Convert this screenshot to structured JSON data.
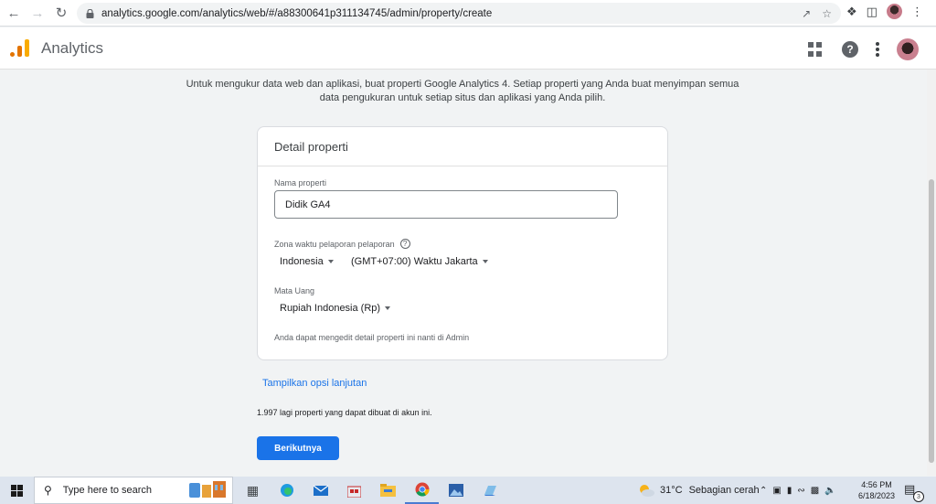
{
  "browser": {
    "url": "analytics.google.com/analytics/web/#/a88300641p311134745/admin/property/create",
    "icons": [
      "back-icon",
      "forward-icon",
      "reload-icon",
      "lock-icon",
      "share-icon",
      "star-icon",
      "extensions-icon",
      "side-panel-icon",
      "profile-avatar"
    ]
  },
  "header": {
    "app_title": "Analytics"
  },
  "intro": {
    "text": "Untuk mengukur data web dan aplikasi, buat properti Google Analytics 4. Setiap properti yang Anda buat menyimpan semua data pengukuran untuk setiap situs dan aplikasi yang Anda pilih."
  },
  "card": {
    "title": "Detail properti",
    "name_label": "Nama properti",
    "name_value": "Didik GA4",
    "timezone_label": "Zona waktu pelaporan pelaporan",
    "timezone_help": "?",
    "country_value": "Indonesia",
    "timezone_value": "(GMT+07:00) Waktu Jakarta",
    "currency_label": "Mata Uang",
    "currency_value": "Rupiah Indonesia (Rp)",
    "note": "Anda dapat mengedit detail properti ini nanti di Admin"
  },
  "advanced_link": "Tampilkan opsi lanjutan",
  "remaining_text": "1.997 lagi properti yang dapat dibuat di akun ini.",
  "next_button": "Berikutnya",
  "taskbar": {
    "search_placeholder": "Type here to search",
    "weather_temp": "31°C",
    "weather_desc": "Sebagian cerah",
    "time": "4:56 PM",
    "date": "6/18/2023",
    "notification_count": "3"
  },
  "colors": {
    "primary": "#1a73e8",
    "ga_orange": "#e37400",
    "ga_yellow": "#f9ab00",
    "background": "#f1f3f4"
  }
}
